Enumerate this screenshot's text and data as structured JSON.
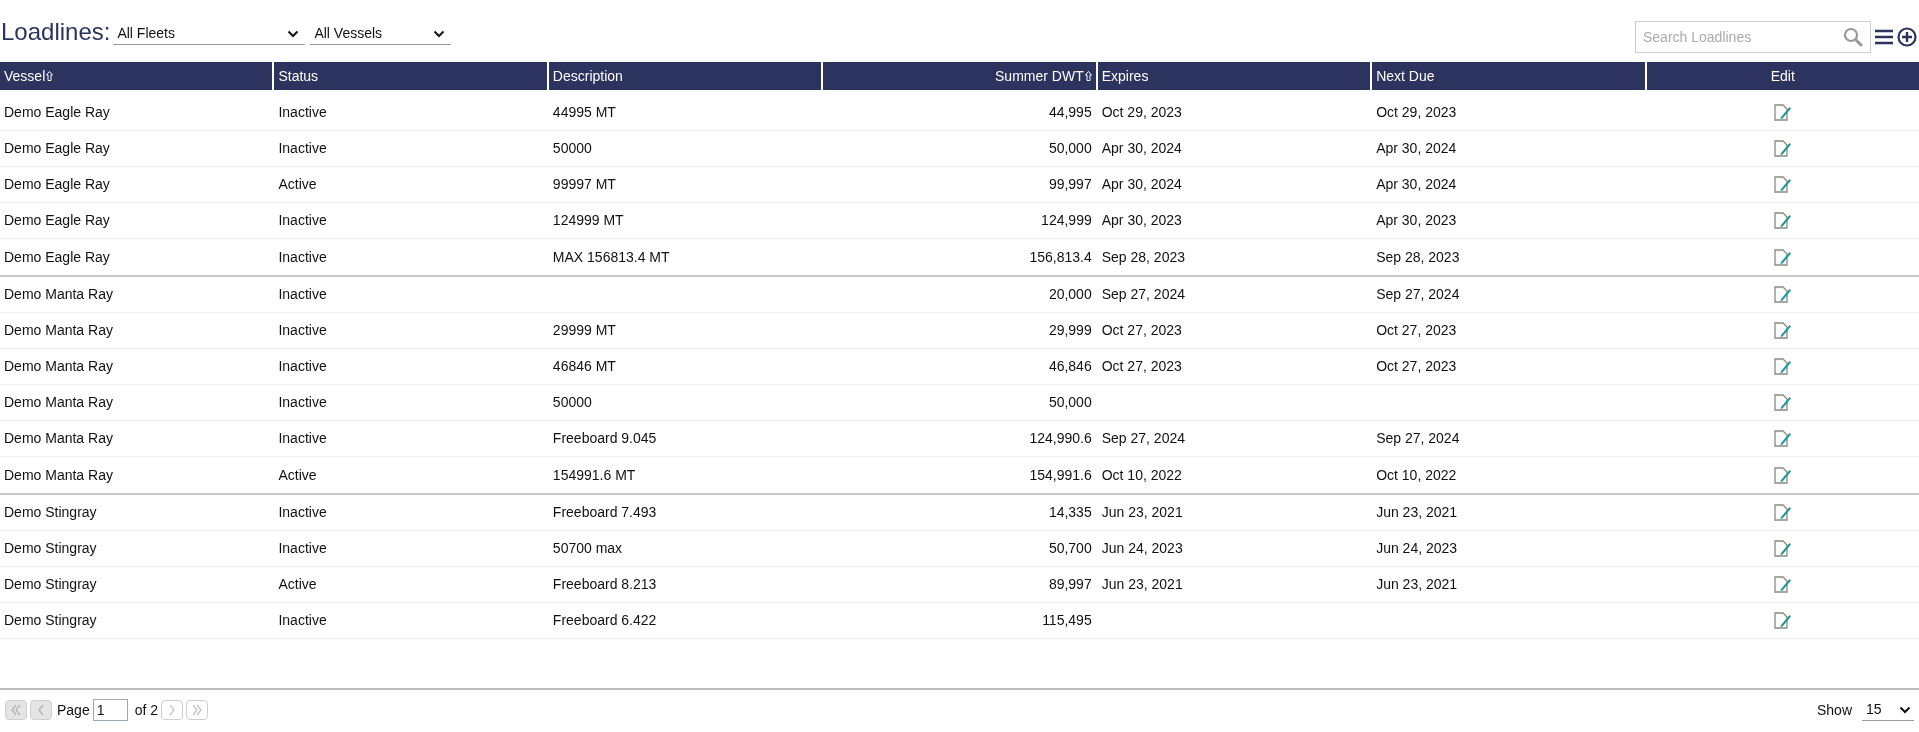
{
  "title": "Loadlines:",
  "filters": [
    {
      "value": "All Fleets"
    },
    {
      "value": "All Vessels"
    }
  ],
  "search": {
    "placeholder": "Search Loadlines"
  },
  "columns": [
    {
      "label": "Vessel",
      "kind": "text",
      "sortable": true
    },
    {
      "label": "Status",
      "kind": "text",
      "sortable": false
    },
    {
      "label": "Description",
      "kind": "text",
      "sortable": false
    },
    {
      "label": "Summer DWT",
      "kind": "number",
      "sortable": true
    },
    {
      "label": "Expires",
      "kind": "text",
      "sortable": false
    },
    {
      "label": "Next Due",
      "kind": "text",
      "sortable": false
    },
    {
      "label": "Edit",
      "kind": "action",
      "sortable": false
    }
  ],
  "groups": [
    {
      "rows": [
        {
          "vessel": "Demo Eagle Ray",
          "status": "Inactive",
          "description": "44995 MT",
          "dwt": "44,995",
          "expires": "Oct 29, 2023",
          "next_due": "Oct 29, 2023"
        },
        {
          "vessel": "Demo Eagle Ray",
          "status": "Inactive",
          "description": "50000",
          "dwt": "50,000",
          "expires": "Apr 30, 2024",
          "next_due": "Apr 30, 2024"
        },
        {
          "vessel": "Demo Eagle Ray",
          "status": "Active",
          "description": "99997 MT",
          "dwt": "99,997",
          "expires": "Apr 30, 2024",
          "next_due": "Apr 30, 2024"
        },
        {
          "vessel": "Demo Eagle Ray",
          "status": "Inactive",
          "description": "124999 MT",
          "dwt": "124,999",
          "expires": "Apr 30, 2023",
          "next_due": "Apr 30, 2023"
        },
        {
          "vessel": "Demo Eagle Ray",
          "status": "Inactive",
          "description": "MAX 156813.4 MT",
          "dwt": "156,813.4",
          "expires": "Sep 28, 2023",
          "next_due": "Sep 28, 2023"
        }
      ]
    },
    {
      "rows": [
        {
          "vessel": "Demo Manta Ray",
          "status": "Inactive",
          "dwt": "20,000",
          "expires": "Sep 27, 2024",
          "next_due": "Sep 27, 2024"
        },
        {
          "vessel": "Demo Manta Ray",
          "status": "Inactive",
          "description": "29999 MT",
          "dwt": "29,999",
          "expires": "Oct 27, 2023",
          "next_due": "Oct 27, 2023"
        },
        {
          "vessel": "Demo Manta Ray",
          "status": "Inactive",
          "description": "46846 MT",
          "dwt": "46,846",
          "expires": "Oct 27, 2023",
          "next_due": "Oct 27, 2023"
        },
        {
          "vessel": "Demo Manta Ray",
          "status": "Inactive",
          "description": "50000",
          "dwt": "50,000"
        },
        {
          "vessel": "Demo Manta Ray",
          "status": "Inactive",
          "description": "Freeboard 9.045",
          "dwt": "124,990.6",
          "expires": "Sep 27, 2024",
          "next_due": "Sep 27, 2024"
        },
        {
          "vessel": "Demo Manta Ray",
          "status": "Active",
          "description": "154991.6 MT",
          "dwt": "154,991.6",
          "expires": "Oct 10, 2022",
          "next_due": "Oct 10, 2022"
        }
      ]
    },
    {
      "rows": [
        {
          "vessel": "Demo Stingray",
          "status": "Inactive",
          "description": "Freeboard 7.493",
          "dwt": "14,335",
          "expires": "Jun 23, 2021",
          "next_due": "Jun 23, 2021"
        },
        {
          "vessel": "Demo Stingray",
          "status": "Inactive",
          "description": "50700 max",
          "dwt": "50,700",
          "expires": "Jun 24, 2023",
          "next_due": "Jun 24, 2023"
        },
        {
          "vessel": "Demo Stingray",
          "status": "Active",
          "description": "Freeboard 8.213",
          "dwt": "89,997",
          "expires": "Jun 23, 2021",
          "next_due": "Jun 23, 2021"
        },
        {
          "vessel": "Demo Stingray",
          "status": "Inactive",
          "description": "Freeboard 6.422",
          "dwt": "115,495"
        }
      ]
    }
  ],
  "pager": {
    "first": {
      "disabled": true
    },
    "prev": {
      "disabled": true
    },
    "page_label": "Page",
    "page": "1",
    "of_label": "of 2",
    "next": {
      "disabled": false
    },
    "last": {
      "disabled": false
    },
    "show_label": "Show",
    "page_size": "15"
  }
}
